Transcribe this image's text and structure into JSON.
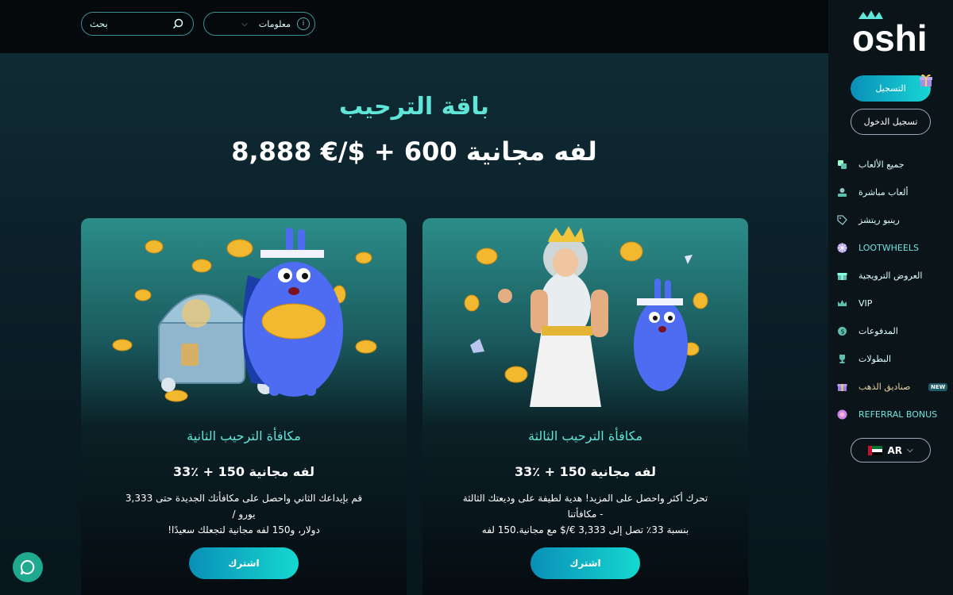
{
  "header": {
    "search_placeholder": "بحث",
    "info_label": "معلومات"
  },
  "hero": {
    "title": "باقة الترحيب",
    "subtitle": "8,888 €/$ + 600 لفه مجانية"
  },
  "cards": [
    {
      "title": "مكافأة الترحيب الثانية",
      "offer": "33٪ + 150 لفه مجانية",
      "desc_line1": "قم بإيداعك الثاني واحصل على مكافأتك الجديدة حتى 3,333 يورو /",
      "desc_line2": "دولار، و150 لفه مجانية لتجعلك سعيدًا!",
      "button": "اشترك"
    },
    {
      "title": "مكافأة الترحيب الثالثة",
      "offer": "33٪ + 150 لفه مجانية",
      "desc_line1": "تحرك أكثر واحصل على المزيد! هدية لطيفة على وديعتك الثالثة - مكافأتنا",
      "desc_line2": "بنسبة 33٪ تصل إلى 3,333 €/$ مع مجانية.150 لفه",
      "button": "اشترك"
    }
  ],
  "sidebar": {
    "logo": "oshi",
    "register": "التسجيل",
    "login": "تسجيل الدخول",
    "items": [
      {
        "label": "جميع الألعاب",
        "icon": "all-games-icon"
      },
      {
        "label": "ألعاب مباشرة",
        "icon": "live-dealer-icon"
      },
      {
        "label": "رينبو ريتشز",
        "icon": "tag-icon"
      },
      {
        "label": "LOOTWHEELS",
        "icon": "wheel-icon"
      },
      {
        "label": "العروض الترويجية",
        "icon": "gift-icon"
      },
      {
        "label": "VIP",
        "icon": "crown-icon"
      },
      {
        "label": "المدفوعات",
        "icon": "coin-icon"
      },
      {
        "label": "البطولات",
        "icon": "trophy-icon"
      },
      {
        "label": "صناديق الذهب",
        "icon": "gold-box-icon",
        "badge": "NEW"
      },
      {
        "label": "REFERRAL BONUS",
        "icon": "referral-icon"
      }
    ],
    "lang": "AR"
  },
  "colors": {
    "accent": "#5fe6d8",
    "button_start": "#0a8fb8",
    "button_end": "#15d8d0",
    "chat": "#1fa98f"
  }
}
